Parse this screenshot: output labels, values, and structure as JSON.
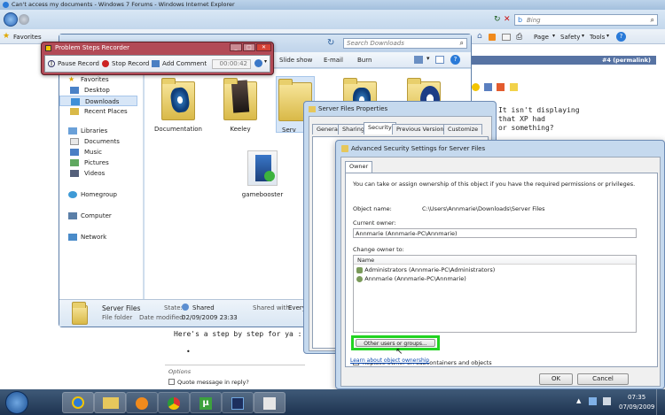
{
  "ie": {
    "title": "Can't access my documents - Windows 7 Forums - Windows Internet Explorer",
    "search_placeholder": "Bing",
    "favorites_label": "Favorites",
    "commands": [
      "Page",
      "Safety",
      "Tools"
    ],
    "permalink": "#4 (permalink)",
    "post_text": [
      "It isn't displaying",
      "that XP had",
      "or something?"
    ],
    "reply_text": "Here's a step by step for ya :)",
    "bullet": "•",
    "options_label": "Options",
    "options_text": "Quote message in reply?"
  },
  "psr": {
    "title": "Problem Steps Recorder",
    "pause": "Pause Record",
    "stop": "Stop Record",
    "add_comment": "Add Comment",
    "timer": "00:00:42"
  },
  "explorer": {
    "search_placeholder": "Search Downloads",
    "toolbar": [
      "Slide show",
      "E-mail",
      "Burn"
    ],
    "nav": {
      "favorites": "Favorites",
      "favorites_items": [
        "Desktop",
        "Downloads",
        "Recent Places"
      ],
      "libraries": "Libraries",
      "libraries_items": [
        "Documents",
        "Music",
        "Pictures",
        "Videos"
      ],
      "homegroup": "Homegroup",
      "computer": "Computer",
      "network": "Network"
    },
    "files": [
      "Documentation",
      "Keeley",
      "Serv",
      "gamebooster"
    ],
    "details": {
      "name": "Server Files",
      "type": "File folder",
      "state_label": "State:",
      "state_value": "Shared",
      "modified_label": "Date modified:",
      "modified_value": "02/09/2009 23:33",
      "shared_label": "Shared with:",
      "shared_value": "Every"
    }
  },
  "props": {
    "title": "Server Files Properties",
    "tabs": [
      "General",
      "Sharing",
      "Security",
      "Previous Versions",
      "Customize"
    ]
  },
  "adv": {
    "title": "Advanced Security Settings for Server Files",
    "tab": "Owner",
    "description": "You can take or assign ownership of this object if you have the required permissions or privileges.",
    "object_name_label": "Object name:",
    "object_name_value": "C:\\Users\\Annmarie\\Downloads\\Server Files",
    "current_owner_label": "Current owner:",
    "current_owner_value": "Annmarie (Annmarie-PC\\Annmarie)",
    "change_owner_label": "Change owner to:",
    "list_header": "Name",
    "owners": [
      "Administrators (Annmarie-PC\\Administrators)",
      "Annmarie (Annmarie-PC\\Annmarie)"
    ],
    "other_users_button": "Other users or groups...",
    "replace_label": "Replace owner on subcontainers and objects",
    "learn_link": "Learn about object ownership",
    "ok": "OK",
    "cancel": "Cancel"
  },
  "taskbar": {
    "time": "07:35",
    "date": "07/09/2009"
  },
  "colors": {
    "highlight": "#22d322",
    "stop_red": "#cc2222"
  }
}
